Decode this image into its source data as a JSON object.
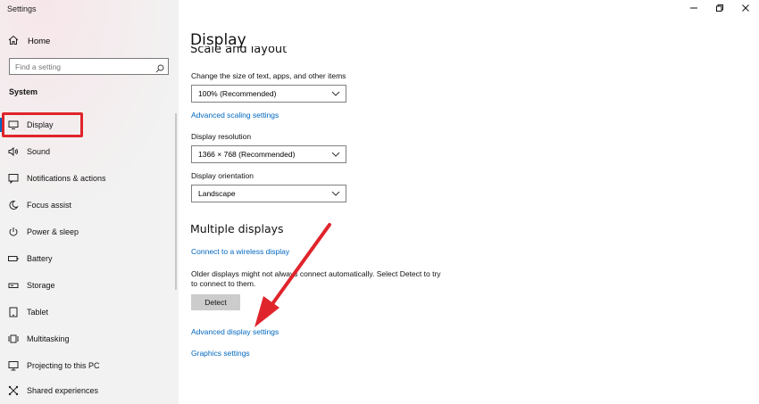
{
  "window": {
    "app_title": "Settings",
    "controls": {
      "minimize_icon": "minimize-icon",
      "restore_icon": "restore-icon",
      "close_icon": "close-icon"
    }
  },
  "sidebar": {
    "home_label": "Home",
    "search": {
      "placeholder": "Find a setting",
      "icon": "search-icon"
    },
    "section_header": "System",
    "items": [
      {
        "label": "Display",
        "icon": "display-icon",
        "active": true
      },
      {
        "label": "Sound",
        "icon": "sound-icon"
      },
      {
        "label": "Notifications & actions",
        "icon": "notifications-icon"
      },
      {
        "label": "Focus assist",
        "icon": "focus-assist-icon"
      },
      {
        "label": "Power & sleep",
        "icon": "power-icon"
      },
      {
        "label": "Battery",
        "icon": "battery-icon"
      },
      {
        "label": "Storage",
        "icon": "storage-icon"
      },
      {
        "label": "Tablet",
        "icon": "tablet-icon"
      },
      {
        "label": "Multitasking",
        "icon": "multitasking-icon"
      },
      {
        "label": "Projecting to this PC",
        "icon": "projecting-icon"
      },
      {
        "label": "Shared experiences",
        "icon": "shared-experiences-icon"
      }
    ]
  },
  "main": {
    "title": "Display",
    "cutoff_heading": "Scale and layout",
    "scale": {
      "label": "Change the size of text, apps, and other items",
      "value": "100% (Recommended)",
      "advanced_link": "Advanced scaling settings"
    },
    "resolution": {
      "label": "Display resolution",
      "value": "1366 × 768 (Recommended)"
    },
    "orientation": {
      "label": "Display orientation",
      "value": "Landscape"
    },
    "multiple_displays": {
      "heading": "Multiple displays",
      "wireless_link": "Connect to a wireless display",
      "description": "Older displays might not always connect automatically. Select Detect to try to connect to them.",
      "detect_button": "Detect",
      "advanced_display_link": "Advanced display settings",
      "graphics_link": "Graphics settings"
    }
  },
  "annotation": {
    "highlight_color": "#e0242b",
    "arrow_color": "#e0242b"
  }
}
